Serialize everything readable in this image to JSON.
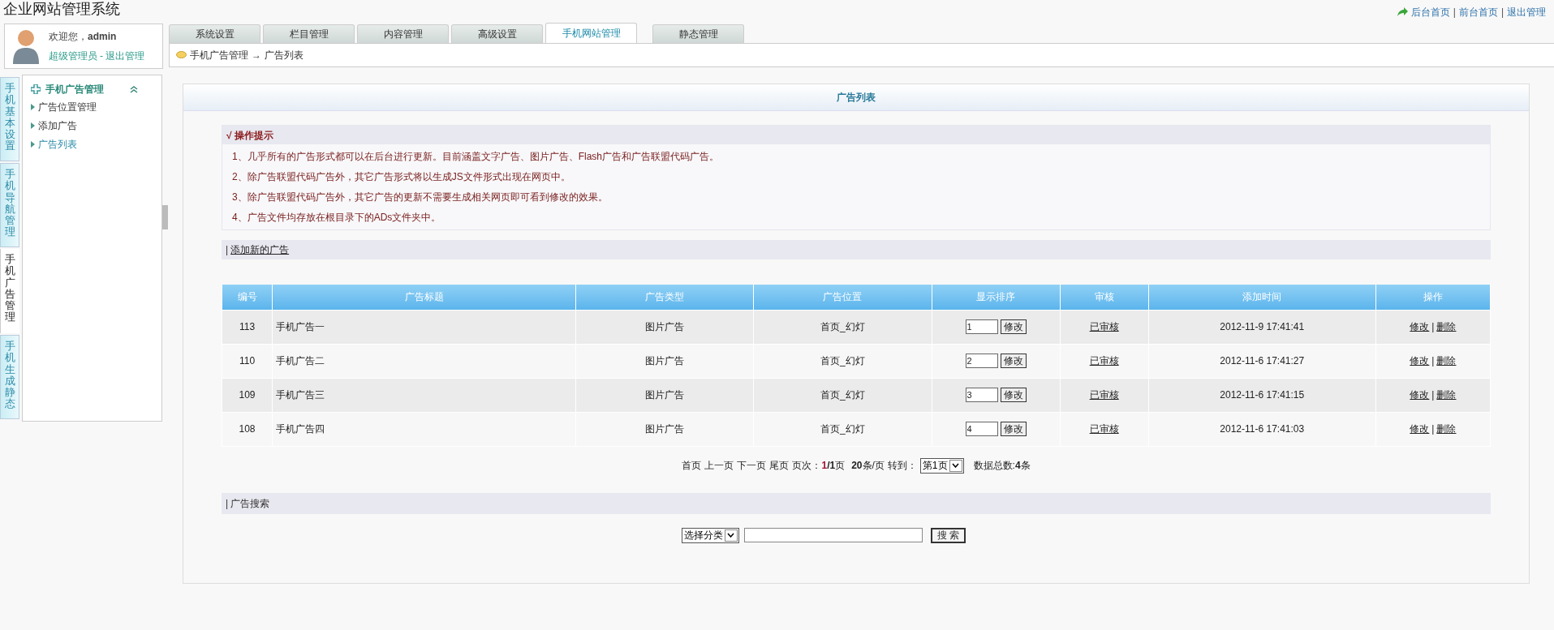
{
  "header": {
    "title": "企业网站管理系统",
    "links": [
      "后台首页",
      "前台首页",
      "退出管理"
    ],
    "link_separator": "|"
  },
  "user": {
    "greeting": "欢迎您，",
    "name": "admin",
    "role": "超级管理员",
    "separator": "-",
    "logout": "退出管理"
  },
  "tabs": [
    {
      "label": "系统设置",
      "selected": false
    },
    {
      "label": "栏目管理",
      "selected": false
    },
    {
      "label": "内容管理",
      "selected": false
    },
    {
      "label": "高级设置",
      "selected": false
    },
    {
      "label": "手机网站管理",
      "selected": true
    },
    {
      "label": "静态管理",
      "selected": false
    }
  ],
  "breadcrumb": {
    "items": [
      "手机广告管理",
      "广告列表"
    ],
    "separator": "→"
  },
  "side_tabs": [
    {
      "label": "手机基本设置",
      "selected": false
    },
    {
      "label": "手机导航管理",
      "selected": false
    },
    {
      "label": "手机广告管理",
      "selected": true
    },
    {
      "label": "手机生成静态",
      "selected": false
    }
  ],
  "menu": {
    "title": "手机广告管理",
    "expanded": true,
    "items": [
      "广告位置管理",
      "添加广告",
      "广告列表"
    ]
  },
  "panel_title": "广告列表",
  "tips": {
    "title": "√ 操作提示",
    "items": [
      "1、几乎所有的广告形式都可以在后台进行更新。目前涵盖文字广告、图片广告、Flash广告和广告联盟代码广告。",
      "2、除广告联盟代码广告外，其它广告形式将以生成JS文件形式出现在网页中。",
      "3、除广告联盟代码广告外，其它广告的更新不需要生成相关网页即可看到修改的效果。",
      "4、广告文件均存放在根目录下的ADs文件夹中。"
    ]
  },
  "add_bar": {
    "prefix": "|",
    "link": "添加新的广告"
  },
  "table": {
    "columns": [
      "编号",
      "广告标题",
      "广告类型",
      "广告位置",
      "显示排序",
      "审核",
      "添加时间",
      "操作"
    ],
    "rows": [
      {
        "id": "113",
        "title": "手机广告一",
        "type": "图片广告",
        "position": "首页_幻灯",
        "order": "1",
        "order_button": "修改",
        "status": "已审核",
        "time": "2012-11-9 17:41:41",
        "actions": [
          "修改",
          "删除"
        ]
      },
      {
        "id": "110",
        "title": "手机广告二",
        "type": "图片广告",
        "position": "首页_幻灯",
        "order": "2",
        "order_button": "修改",
        "status": "已审核",
        "time": "2012-11-6 17:41:27",
        "actions": [
          "修改",
          "删除"
        ]
      },
      {
        "id": "109",
        "title": "手机广告三",
        "type": "图片广告",
        "position": "首页_幻灯",
        "order": "3",
        "order_button": "修改",
        "status": "已审核",
        "time": "2012-11-6 17:41:15",
        "actions": [
          "修改",
          "删除"
        ]
      },
      {
        "id": "108",
        "title": "手机广告四",
        "type": "图片广告",
        "position": "首页_幻灯",
        "order": "4",
        "order_button": "修改",
        "status": "已审核",
        "time": "2012-11-6 17:41:03",
        "actions": [
          "修改",
          "删除"
        ]
      }
    ],
    "action_separator": "|"
  },
  "pagination": {
    "links": [
      "首页",
      "上一页",
      "下一页",
      "尾页"
    ],
    "page_label": "页次：",
    "current": "1",
    "total": "/1",
    "page_unit": "页",
    "per_page": "20",
    "per_page_unit": "条/页",
    "goto_label": "转到：",
    "goto_value": "第1页",
    "count_label": "数据总数:",
    "count": "4",
    "count_unit": "条"
  },
  "search": {
    "prefix": "|",
    "title": "广告搜索",
    "category": "选择分类",
    "button": "搜 索"
  }
}
